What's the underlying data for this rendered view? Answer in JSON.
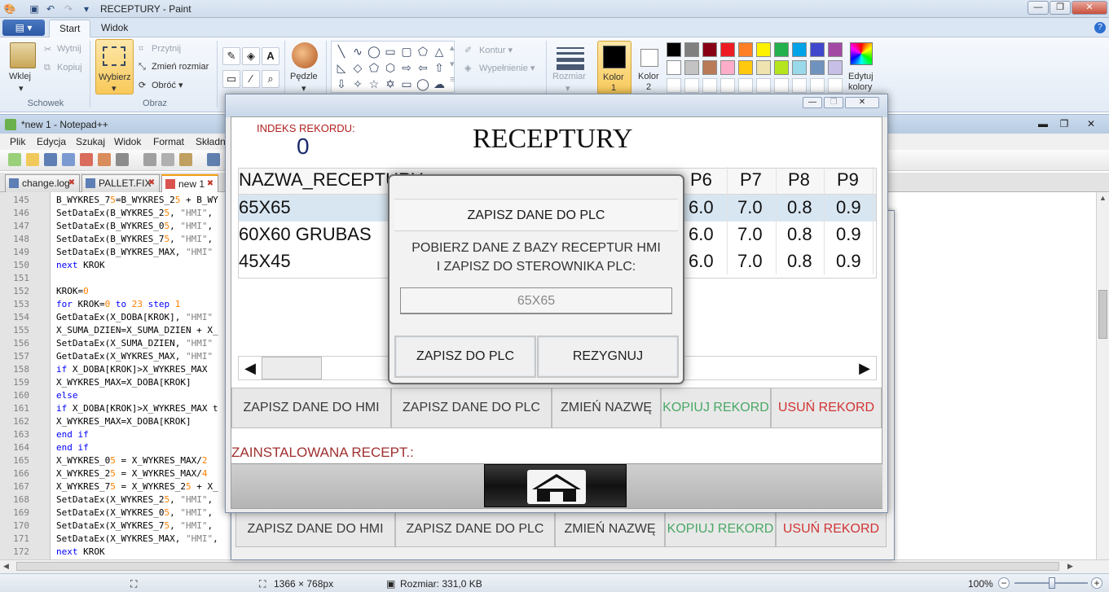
{
  "paint": {
    "title": "RECEPTURY - Paint",
    "file_menu": "▤ ▾",
    "tabs": [
      "Start",
      "Widok"
    ],
    "clipboard": {
      "paste": "Wklej",
      "cut": "Wytnij",
      "copy": "Kopiuj",
      "group": "Schowek"
    },
    "image": {
      "select": "Wybierz",
      "crop": "Przytnij",
      "resize": "Zmień rozmiar",
      "rotate": "Obróć ▾",
      "group": "Obraz"
    },
    "tools": {
      "brush": "Pędzle"
    },
    "shapes": {
      "outline": "Kontur ▾",
      "fill": "Wypełnienie ▾"
    },
    "size_label": "Rozmiar",
    "color1": {
      "label": "Kolor",
      "index": "1"
    },
    "color2": {
      "label": "Kolor",
      "index": "2"
    },
    "edit_colors": {
      "line1": "Edytuj",
      "line2": "kolory"
    },
    "palette_row1": [
      "#000000",
      "#7f7f7f",
      "#880015",
      "#ed1c24",
      "#ff7f27",
      "#fff200",
      "#22b14c",
      "#00a2e8",
      "#3f48cc",
      "#a349a4"
    ],
    "palette_row2": [
      "#ffffff",
      "#c3c3c3",
      "#b97a57",
      "#ffaec9",
      "#ffc90e",
      "#efe4b0",
      "#b5e61d",
      "#99d9ea",
      "#7092be",
      "#c8bfe7"
    ],
    "status": {
      "dimensions": "1366 × 768px",
      "size": "Rozmiar: 331,0 KB",
      "zoom": "100%"
    }
  },
  "notepad": {
    "title": "*new 1 - Notepad++",
    "menu": [
      "Plik",
      "Edycja",
      "Szukaj",
      "Widok",
      "Format",
      "Składn"
    ],
    "tabs": [
      {
        "label": "change.log"
      },
      {
        "label": "PALLET.FIX"
      },
      {
        "label": "new 1"
      }
    ],
    "line_numbers": [
      "145",
      "146",
      "147",
      "148",
      "149",
      "150",
      "151",
      "152",
      "153",
      "154",
      "155",
      "156",
      "157",
      "158",
      "159",
      "160",
      "161",
      "162",
      "163",
      "164",
      "165",
      "166",
      "167",
      "168",
      "169",
      "170",
      "171",
      "172"
    ],
    "lines": [
      "B_WYKRES_75=B_WYKRES_25 + B_WY",
      "SetDataEx(B_WYKRES_25, \"HMI\",",
      "SetDataEx(B_WYKRES_05, \"HMI\",",
      "SetDataEx(B_WYKRES_75, \"HMI\",",
      "SetDataEx(B_WYKRES_MAX, \"HMI\"",
      "next KROK",
      "",
      "KROK=0",
      "for KROK=0 to 23 step 1",
      "GetDataEx(X_DOBA[KROK], \"HMI\"",
      "X_SUMA_DZIEN=X_SUMA_DZIEN + X_",
      "SetDataEx(X_SUMA_DZIEN, \"HMI\"",
      "GetDataEx(X_WYKRES_MAX, \"HMI\"",
      "if X_DOBA[KROK]>X_WYKRES_MAX",
      "X_WYKRES_MAX=X_DOBA[KROK]",
      "else",
      "if X_DOBA[KROK]>X_WYKRES_MAX t",
      "X_WYKRES_MAX=X_DOBA[KROK]",
      "end if",
      "end if",
      "X_WYKRES_05 = X_WYKRES_MAX/2",
      "X_WYKRES_25 = X_WYKRES_MAX/4",
      "X_WYKRES_75 = X_WYKRES_25 + X_",
      "SetDataEx(X_WYKRES_25, \"HMI\",",
      "SetDataEx(X_WYKRES_05, \"HMI\",",
      "SetDataEx(X_WYKRES_75, \"HMI\",",
      "SetDataEx(X_WYKRES_MAX, \"HMI\",",
      "next KROK"
    ]
  },
  "hmi": {
    "index_label": "INDEKS REKORDU:",
    "index_value": "0",
    "title": "RECEPTURY",
    "table": {
      "name_header": "NAZWA_RECEPTURY",
      "headers_right": [
        "P6",
        "P7",
        "P8",
        "P9"
      ],
      "rows": [
        {
          "name": "65X65",
          "p6": "6.0",
          "p7": "7.0",
          "p8": "0.8",
          "p9": "0.9"
        },
        {
          "name": "60X60 GRUBAS",
          "p6": "6.0",
          "p7": "7.0",
          "p8": "0.8",
          "p9": "0.9"
        },
        {
          "name": "45X45",
          "p6": "6.0",
          "p7": "7.0",
          "p8": "0.8",
          "p9": "0.9"
        }
      ]
    },
    "buttons": {
      "save_hmi": "ZAPISZ DANE DO HMI",
      "save_plc": "ZAPISZ DANE DO PLC",
      "rename": "ZMIEŃ NAZWĘ",
      "copy": "KOPIUJ REKORD",
      "delete": "USUŃ REKORD"
    },
    "installed_label": "ZAINSTALOWANA RECEPT.:"
  },
  "dialog": {
    "title": "ZAPISZ DANE DO PLC",
    "message_line1": "POBIERZ DANE Z BAZY RECEPTUR HMI",
    "message_line2": "I ZAPISZ DO STEROWNIKA PLC:",
    "value": "65X65",
    "confirm": "ZAPISZ DO PLC",
    "cancel": "REZYGNUJ"
  }
}
